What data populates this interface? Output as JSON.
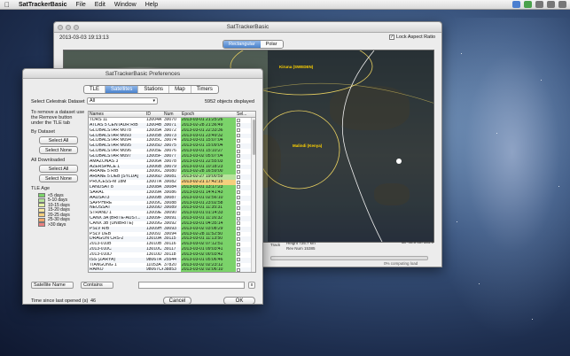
{
  "menubar": {
    "apple": "",
    "app_name": "SatTrackerBasic",
    "items": [
      "File",
      "Edit",
      "Window",
      "Help"
    ]
  },
  "main_window": {
    "title": "SatTrackerBasic",
    "datetime": "2013-03-03  19:13:13",
    "view_modes": [
      "Rectangular",
      "Polar"
    ],
    "active_view": "Rectangular",
    "lock_aspect_label": "Lock Aspect Ratio",
    "lock_aspect_checked": true,
    "map_labels": {
      "kiruna": "Kiruna (SWEDEN)",
      "malindi": "Malindi (Kenya)"
    },
    "status": {
      "track": "Track",
      "height": "Height 725.7 km",
      "rev": "Rev Num 15385",
      "latlon": "lat  -46.9  lon 151.9",
      "load": "0% computing load"
    }
  },
  "prefs": {
    "title": "SatTrackerBasic Preferences",
    "tabs": [
      "TLE",
      "Satellites",
      "Stations",
      "Map",
      "Timers"
    ],
    "active_tab": "Satellites",
    "dataset_label": "Select Celestrak Dataset",
    "dataset_value": "All",
    "object_count": "5952 objects displayed",
    "remove_note": "To remove a dataset use the Remove button under the TLE tab",
    "by_dataset": "By Dataset",
    "select_all": "Select All",
    "select_none": "Select None",
    "all_downloaded": "All Downloaded",
    "tle_age_label": "TLE Age",
    "tle_age": [
      {
        "label": "<5 days",
        "color": "#7bd36a"
      },
      {
        "label": "5-10 days",
        "color": "#b6e39a"
      },
      {
        "label": "10-15 days",
        "color": "#e6f2a6"
      },
      {
        "label": "15-20 days",
        "color": "#f7e7a0"
      },
      {
        "label": "20-25 days",
        "color": "#f5cf7d"
      },
      {
        "label": "25-30 days",
        "color": "#f0a86a"
      },
      {
        "label": ">30 days",
        "color": "#e98080"
      }
    ],
    "columns": [
      "Names",
      "ID",
      "Num",
      "Epoch",
      "Sel..."
    ],
    "rows": [
      [
        "TDRS 11",
        "13004A",
        "39070",
        "2013-03-01 21:25:26",
        "#7bd36a"
      ],
      [
        "ATLAS 5 CENTAUR R/B",
        "13004B",
        "39071",
        "2013-02-28 21:36:49",
        "#7bd36a"
      ],
      [
        "GLOBALSTAR M078",
        "13005A",
        "39072",
        "2013-03-01 22:33:36",
        "#7bd36a"
      ],
      [
        "GLOBALSTAR M093",
        "13005B",
        "39073",
        "2013-03-01 23:49:32",
        "#7bd36a"
      ],
      [
        "GLOBALSTAR M094",
        "13005C",
        "39074",
        "2013-03-01 15:07:04",
        "#7bd36a"
      ],
      [
        "GLOBALSTAR M095",
        "13005D",
        "39075",
        "2013-03-01 15:09:04",
        "#7bd36a"
      ],
      [
        "GLOBALSTAR M096",
        "13005E",
        "39076",
        "2013-03-01 15:10:27",
        "#7bd36a"
      ],
      [
        "GLOBALSTAR M097",
        "13005F",
        "39077",
        "2013-03-02 05:07:04",
        "#7bd36a"
      ],
      [
        "AMAZONAS 3",
        "13006A",
        "39078",
        "2013-03-01 22:55:03",
        "#7bd36a"
      ],
      [
        "AZERSPACE 1",
        "13006B",
        "39079",
        "2013-03-01 10:18:23",
        "#7bd36a"
      ],
      [
        "ARIANE 5 R/B",
        "13006C",
        "39080",
        "2013-02-28 16:59:00",
        "#7bd36a"
      ],
      [
        "ARIANE 5 DEB [SYLDA]",
        "13006D",
        "39081",
        "2013-02-27 19:00:59",
        "#b6e39a"
      ],
      [
        "PROCESS-M 18M",
        "13007A",
        "39082",
        "2013-02-21 17:42:15",
        "#f5cf7d"
      ],
      [
        "LANDSAT 8",
        "13008A",
        "39084",
        "2013-03-01 13:17:23",
        "#7bd36a"
      ],
      [
        "SARAL",
        "13009A",
        "39086",
        "2013-03-01 14:41:43",
        "#7bd36a"
      ],
      [
        "AAUSAT3",
        "13009B",
        "39087",
        "2013-03-01 02:56:10",
        "#7bd36a"
      ],
      [
        "SAPPHIRE",
        "13009C",
        "39088",
        "2013-03-01 23:02:58",
        "#7bd36a"
      ],
      [
        "NEOSSAT",
        "13009D",
        "39089",
        "2013-03-01 11:35:31",
        "#7bd36a"
      ],
      [
        "STRAND 1",
        "13009E",
        "39090",
        "2013-03-01 01:14:33",
        "#7bd36a"
      ],
      [
        "CANX 3A (BRITE-AUST...",
        "13009F",
        "39091",
        "2013-03-01 11:16:32",
        "#7bd36a"
      ],
      [
        "CANX 3B (UNIBRITE)",
        "13009G",
        "39092",
        "2013-03-01 04:35:14",
        "#7bd36a"
      ],
      [
        "PSLV R/B",
        "13009H",
        "39093",
        "2013-03-02 03:08:29",
        "#7bd36a"
      ],
      [
        "PSLV DEB",
        "13009J",
        "39094",
        "2013-02-28 11:52:50",
        "#7bd36a"
      ],
      [
        "DRAGON CRS-2",
        "13010A",
        "39115",
        "2013-03-01 11:13:50",
        "#7bd36a"
      ],
      [
        "2013-010B",
        "13010B",
        "39116",
        "2013-03-02 07:12:51",
        "#7bd36a"
      ],
      [
        "2013-010C",
        "13010C",
        "39117",
        "2013-03-01 09:03:41",
        "#7bd36a"
      ],
      [
        "2013-010D",
        "13010D",
        "39118",
        "2013-03-02 00:03:42",
        "#7bd36a"
      ],
      [
        "ISS (ZARYA)",
        "98067A",
        "25544",
        "2013-03-01 05:06:46",
        "#7bd36a"
      ],
      [
        "TIANGONG 1",
        "11053A",
        "37820",
        "2013-03-02 02:23:12",
        "#7bd36a"
      ],
      [
        "RAIKO",
        "98067CP",
        "38853",
        "2013-03-02 02:06:10",
        "#7bd36a"
      ],
      [
        "FITSAT-1 (NIWAKA)",
        "98067CF",
        "38853",
        "2013-03-02 03:32:11",
        "#7bd36a"
      ]
    ],
    "filter_field": "Satellite Name",
    "filter_mode": "Contains",
    "filter_clear": "x",
    "since_label": "Time since last opened (s)",
    "since_value": "46",
    "cancel": "Cancel",
    "ok": "OK"
  }
}
